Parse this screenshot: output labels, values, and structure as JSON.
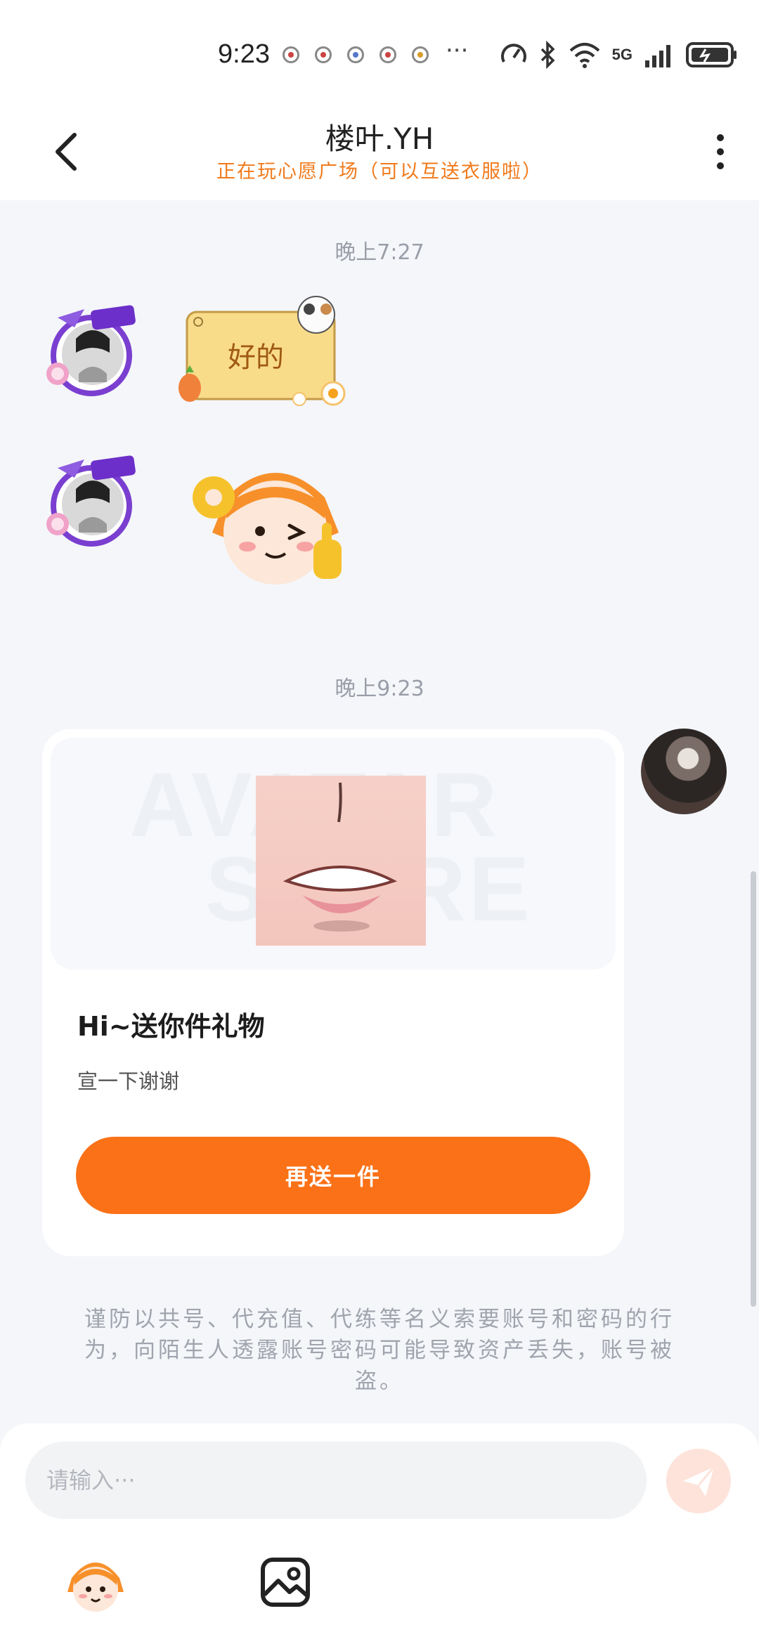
{
  "status_bar": {
    "time": "9:23",
    "network": "5G",
    "more": "···"
  },
  "header": {
    "contact_name": "楼叶.YH",
    "contact_status": "正在玩心愿广场（可以互送衣服啦）"
  },
  "messages": {
    "timestamp_1": "晚上7:27",
    "sticker_1_text": "好的",
    "timestamp_2": "晚上9:23"
  },
  "gift_card": {
    "watermark_line1": "AVATAR",
    "watermark_line2": "STORE",
    "title": "Hi~送你件礼物",
    "subtitle": "宣一下谢谢",
    "button_label": "再送一件"
  },
  "warning_text": "谨防以共号、代充值、代练等名义索要账号和密码的行为，向陌生人透露账号密码可能导致资产丢失，账号被盗。",
  "input": {
    "placeholder": "请输入···"
  },
  "colors": {
    "accent": "#fb7117",
    "status_orange": "#f07a1c",
    "background": "#f4f6fa"
  },
  "icons": {
    "back": "chevron-left-icon",
    "more": "more-vertical-icon",
    "send": "paper-plane-icon",
    "emoji": "emoji-sticker-icon",
    "image": "image-icon"
  }
}
